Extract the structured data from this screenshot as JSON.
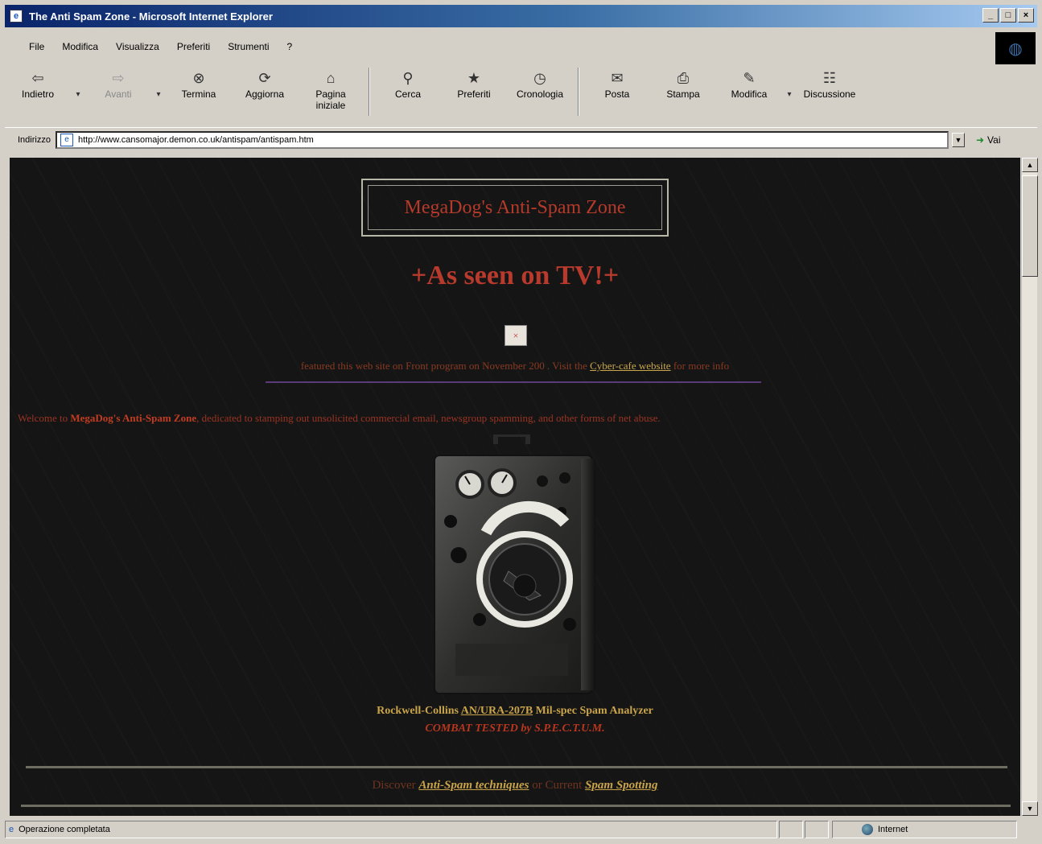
{
  "window": {
    "title": "The Anti Spam Zone - Microsoft Internet Explorer",
    "buttons": {
      "minimize": "_",
      "maximize": "□",
      "close": "×"
    }
  },
  "menu": [
    "File",
    "Modifica",
    "Visualizza",
    "Preferiti",
    "Strumenti",
    "?"
  ],
  "toolbar": {
    "back": "Indietro",
    "forward": "Avanti",
    "stop": "Termina",
    "refresh": "Aggiorna",
    "home": "Pagina iniziale",
    "search": "Cerca",
    "favorites": "Preferiti",
    "history": "Cronologia",
    "mail": "Posta",
    "print": "Stampa",
    "edit": "Modifica",
    "discuss": "Discussione"
  },
  "address": {
    "label": "Indirizzo",
    "url": "http://www.cansomajor.demon.co.uk/antispam/antispam.htm",
    "go": "Vai"
  },
  "page": {
    "site_title": "MegaDog's Anti-Spam Zone",
    "tv_heading": "+As seen on TV!+",
    "broken_image_glyph": "×",
    "tv_line_before": "featured this web site on Front program on November 200 . Visit the",
    "tv_line_link": "Cyber-cafe website",
    "tv_line_after": "for more info",
    "welcome_before": "Welcome to",
    "welcome_bold": "MegaDog's Anti-Spam Zone",
    "welcome_after": ", dedicated to stamping out unsolicited commercial email, newsgroup spamming, and other forms of net abuse.",
    "caption_before": "Rockwell-Collins",
    "caption_link": "AN/URA-207B",
    "caption_after": "Mil-spec Spam Analyzer",
    "caption_line2": "COMBAT TESTED by S.P.E.C.T.U.M.",
    "footer_before": "Discover",
    "footer_link1": "Anti-Spam techniques",
    "footer_middle": "or Current",
    "footer_link2": "Spam Spotting"
  },
  "status": {
    "text": "Operazione completata",
    "zone": "Internet"
  }
}
